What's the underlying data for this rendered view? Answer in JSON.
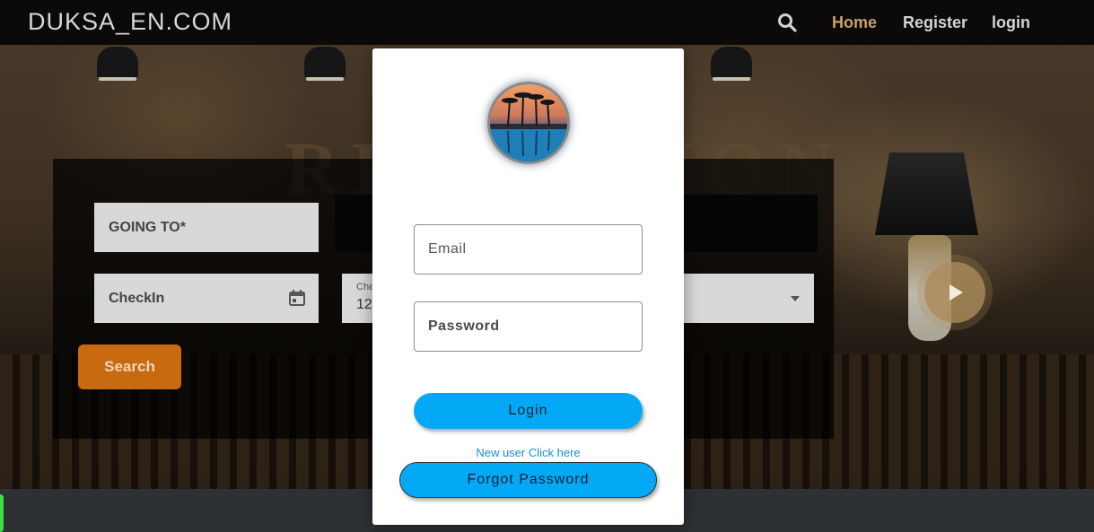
{
  "brand": "DUKSA_EN.COM",
  "nav": {
    "home": "Home",
    "register": "Register",
    "login": "login",
    "search_icon": "search-icon"
  },
  "hero": {
    "wall_sign": "RECEPTION"
  },
  "search_panel": {
    "going_to": "GOING TO*",
    "checkin": "CheckIn",
    "checkout_label": "Che",
    "checkout_value": "12",
    "search_button": "Search"
  },
  "modal": {
    "email_placeholder": "Email",
    "password_placeholder": "Password",
    "login_button": "Login",
    "new_user_link": "New user Click here",
    "forgot_button": "Forgot Password"
  },
  "colors": {
    "accent": "#03a9f4",
    "nav_active": "#c6a16b",
    "search_button": "#c86a10"
  }
}
